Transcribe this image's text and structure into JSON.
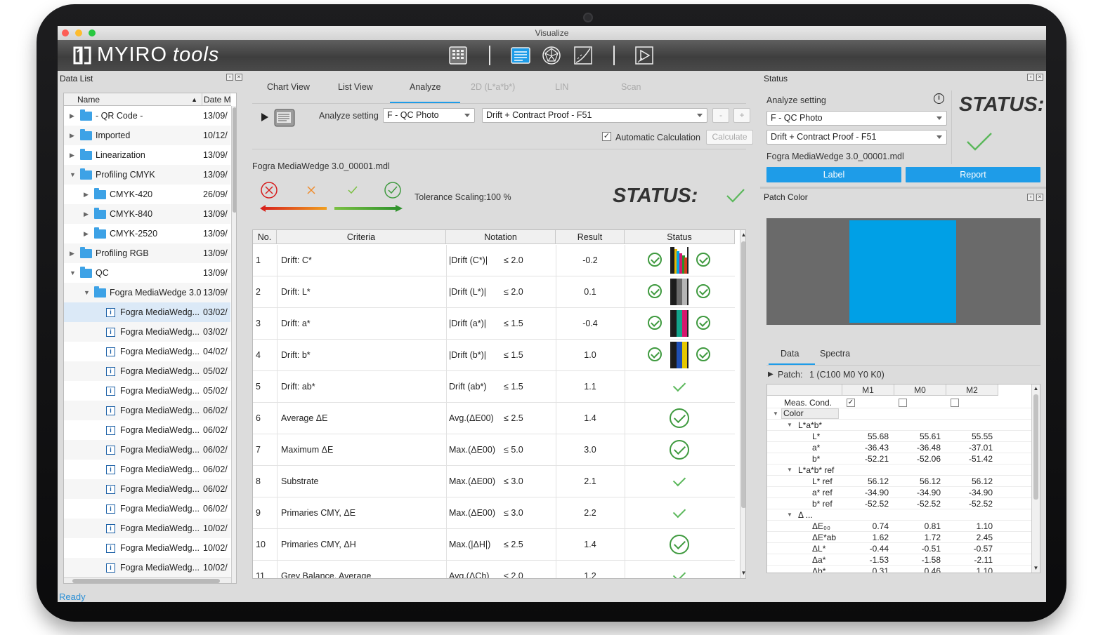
{
  "window_title": "Visualize",
  "brand": {
    "name": "MYIRO",
    "suffix": "tools"
  },
  "colors": {
    "accent": "#1e9ce8",
    "ok": "#3f9a3f",
    "patch": "#00a0e6"
  },
  "toolbar": {
    "icons": [
      "chart-grid-icon",
      "list-view-icon",
      "gamut-3d-icon",
      "curve-graph-icon",
      "slideshow-icon"
    ]
  },
  "data_list": {
    "title": "Data List",
    "col_name": "Name",
    "col_date": "Date M",
    "rows": [
      {
        "label": "- QR Code -",
        "date": "13/09/",
        "level": 0,
        "type": "folder",
        "expander": "closed"
      },
      {
        "label": "Imported",
        "date": "10/12/",
        "level": 0,
        "type": "folder",
        "expander": "closed"
      },
      {
        "label": "Linearization",
        "date": "13/09/",
        "level": 0,
        "type": "folder",
        "expander": "closed"
      },
      {
        "label": "Profiling CMYK",
        "date": "13/09/",
        "level": 0,
        "type": "folder",
        "expander": "open"
      },
      {
        "label": "CMYK-420",
        "date": "26/09/",
        "level": 1,
        "type": "folder",
        "expander": "closed"
      },
      {
        "label": "CMYK-840",
        "date": "13/09/",
        "level": 1,
        "type": "folder",
        "expander": "closed"
      },
      {
        "label": "CMYK-2520",
        "date": "13/09/",
        "level": 1,
        "type": "folder",
        "expander": "closed"
      },
      {
        "label": "Profiling RGB",
        "date": "13/09/",
        "level": 0,
        "type": "folder",
        "expander": "closed"
      },
      {
        "label": "QC",
        "date": "13/09/",
        "level": 0,
        "type": "folder",
        "expander": "open"
      },
      {
        "label": "Fogra MediaWedge 3.0",
        "date": "13/09/",
        "level": 1,
        "type": "folder",
        "expander": "open"
      },
      {
        "label": "Fogra MediaWedg...",
        "date": "03/02/",
        "level": 2,
        "type": "file",
        "selected": true
      },
      {
        "label": "Fogra MediaWedg...",
        "date": "03/02/",
        "level": 2,
        "type": "file"
      },
      {
        "label": "Fogra MediaWedg...",
        "date": "04/02/",
        "level": 2,
        "type": "file"
      },
      {
        "label": "Fogra MediaWedg...",
        "date": "05/02/",
        "level": 2,
        "type": "file"
      },
      {
        "label": "Fogra MediaWedg...",
        "date": "05/02/",
        "level": 2,
        "type": "file"
      },
      {
        "label": "Fogra MediaWedg...",
        "date": "06/02/",
        "level": 2,
        "type": "file"
      },
      {
        "label": "Fogra MediaWedg...",
        "date": "06/02/",
        "level": 2,
        "type": "file"
      },
      {
        "label": "Fogra MediaWedg...",
        "date": "06/02/",
        "level": 2,
        "type": "file"
      },
      {
        "label": "Fogra MediaWedg...",
        "date": "06/02/",
        "level": 2,
        "type": "file"
      },
      {
        "label": "Fogra MediaWedg...",
        "date": "06/02/",
        "level": 2,
        "type": "file"
      },
      {
        "label": "Fogra MediaWedg...",
        "date": "06/02/",
        "level": 2,
        "type": "file"
      },
      {
        "label": "Fogra MediaWedg...",
        "date": "10/02/",
        "level": 2,
        "type": "file"
      },
      {
        "label": "Fogra MediaWedg...",
        "date": "10/02/",
        "level": 2,
        "type": "file"
      },
      {
        "label": "Fogra MediaWedg...",
        "date": "10/02/",
        "level": 2,
        "type": "file"
      }
    ]
  },
  "analyze": {
    "tabs": [
      {
        "label": "Chart View",
        "state": "normal"
      },
      {
        "label": "List View",
        "state": "normal"
      },
      {
        "label": "Analyze",
        "state": "active"
      },
      {
        "label": "2D (L*a*b*)",
        "state": "disabled"
      },
      {
        "label": "LIN",
        "state": "disabled"
      },
      {
        "label": "Scan",
        "state": "disabled"
      }
    ],
    "setting_label": "Analyze setting",
    "setting_value": "F - QC Photo",
    "tolerance_set": "Drift + Contract Proof   - F51",
    "minus_label": "-",
    "plus_label": "+",
    "auto_calc_label": "Automatic Calculation",
    "auto_calc_checked": true,
    "calculate_label": "Calculate",
    "file_name": "Fogra MediaWedge 3.0_00001.mdl",
    "tolerance_text": "Tolerance Scaling:100 %",
    "status_label": "STATUS:",
    "columns": [
      "No.",
      "Criteria",
      "Notation",
      "Result",
      "Status"
    ],
    "rows": [
      {
        "no": "1",
        "criteria": "Drift: C*",
        "notation": "|Drift (C*)|",
        "limit": "≤ 2.0",
        "result": "-0.2",
        "status": "swatch",
        "swatch": [
          "#1c1c1c",
          "#e6b800",
          "#00a6e6",
          "#d6166e",
          "#2a8f2a",
          "#d63a1c"
        ]
      },
      {
        "no": "2",
        "criteria": "Drift: L*",
        "notation": "|Drift (L*)|",
        "limit": "≤ 2.0",
        "result": "0.1",
        "status": "swatch",
        "swatch": [
          "#1c1c1c",
          "#6b6b6b",
          "#b5b5b5"
        ]
      },
      {
        "no": "3",
        "criteria": "Drift: a*",
        "notation": "|Drift (a*)|",
        "limit": "≤ 1.5",
        "result": "-0.4",
        "status": "swatch",
        "swatch": [
          "#1c1c1c",
          "#13a38a",
          "#d6166e"
        ]
      },
      {
        "no": "4",
        "criteria": "Drift: b*",
        "notation": "|Drift (b*)|",
        "limit": "≤ 1.5",
        "result": "1.0",
        "status": "swatch",
        "swatch": [
          "#1c1c1c",
          "#1f4fb4",
          "#e6c800"
        ]
      },
      {
        "no": "5",
        "criteria": "Drift: ab*",
        "notation": "Drift (ab*)",
        "limit": "≤ 1.5",
        "result": "1.1",
        "status": "plain"
      },
      {
        "no": "6",
        "criteria": "Average ΔE",
        "notation": "Avg.(ΔE00)",
        "limit": "≤ 2.5",
        "result": "1.4",
        "status": "circle"
      },
      {
        "no": "7",
        "criteria": "Maximum ΔE",
        "notation": "Max.(ΔE00)",
        "limit": "≤ 5.0",
        "result": "3.0",
        "status": "circle"
      },
      {
        "no": "8",
        "criteria": "Substrate",
        "notation": "Max.(ΔE00)",
        "limit": "≤ 3.0",
        "result": "2.1",
        "status": "plain"
      },
      {
        "no": "9",
        "criteria": "Primaries CMY, ΔE",
        "notation": "Max.(ΔE00)",
        "limit": "≤ 3.0",
        "result": "2.2",
        "status": "plain"
      },
      {
        "no": "10",
        "criteria": "Primaries CMY, ΔH",
        "notation": "Max.(|ΔH|)",
        "limit": "≤ 2.5",
        "result": "1.4",
        "status": "circle"
      },
      {
        "no": "11",
        "criteria": "Grey Balance, Average",
        "notation": "Avg.(ΔCh)",
        "limit": "≤ 2.0",
        "result": "1.2",
        "status": "plain"
      }
    ]
  },
  "status_panel": {
    "title": "Status",
    "setting_label": "Analyze setting",
    "setting_value": "F - QC Photo",
    "tolerance_set": "Drift + Contract Proof   - F51",
    "file_name": "Fogra MediaWedge 3.0_00001.mdl",
    "status_label": "STATUS:",
    "label_button": "Label",
    "report_button": "Report"
  },
  "patch_color": {
    "title": "Patch Color",
    "tabs": [
      {
        "label": "Data",
        "active": true
      },
      {
        "label": "Spectra",
        "active": false
      }
    ],
    "patch_prefix": "Patch:",
    "patch_value": "1 (C100 M0 Y0 K0)",
    "columns": [
      "M1",
      "M0",
      "M2"
    ],
    "rows": [
      {
        "label": "Meas. Cond.",
        "indent": 0,
        "checks": [
          true,
          false,
          false
        ]
      },
      {
        "label": "Color",
        "indent": 0,
        "group": true,
        "expander": "open"
      },
      {
        "label": "L*a*b*",
        "indent": 1,
        "group": true,
        "expander": "open"
      },
      {
        "label": "L*",
        "indent": 2,
        "values": [
          "55.68",
          "55.61",
          "55.55"
        ]
      },
      {
        "label": "a*",
        "indent": 2,
        "values": [
          "-36.43",
          "-36.48",
          "-37.01"
        ]
      },
      {
        "label": "b*",
        "indent": 2,
        "values": [
          "-52.21",
          "-52.06",
          "-51.42"
        ]
      },
      {
        "label": "L*a*b* ref",
        "indent": 1,
        "group": true,
        "expander": "open"
      },
      {
        "label": "L* ref",
        "indent": 2,
        "values": [
          "56.12",
          "56.12",
          "56.12"
        ]
      },
      {
        "label": "a* ref",
        "indent": 2,
        "values": [
          "-34.90",
          "-34.90",
          "-34.90"
        ]
      },
      {
        "label": "b* ref",
        "indent": 2,
        "values": [
          "-52.52",
          "-52.52",
          "-52.52"
        ]
      },
      {
        "label": "Δ ...",
        "indent": 1,
        "group": true,
        "expander": "open"
      },
      {
        "label": "ΔE₀₀",
        "indent": 2,
        "values": [
          "0.74",
          "0.81",
          "1.10"
        ]
      },
      {
        "label": "ΔE*ab",
        "indent": 2,
        "values": [
          "1.62",
          "1.72",
          "2.45"
        ]
      },
      {
        "label": "ΔL*",
        "indent": 2,
        "values": [
          "-0.44",
          "-0.51",
          "-0.57"
        ]
      },
      {
        "label": "Δa*",
        "indent": 2,
        "values": [
          "-1.53",
          "-1.58",
          "-2.11"
        ]
      },
      {
        "label": "Δb*",
        "indent": 2,
        "values": [
          "0.31",
          "0.46",
          "1.10"
        ]
      }
    ]
  },
  "statusbar": {
    "text": "Ready"
  }
}
